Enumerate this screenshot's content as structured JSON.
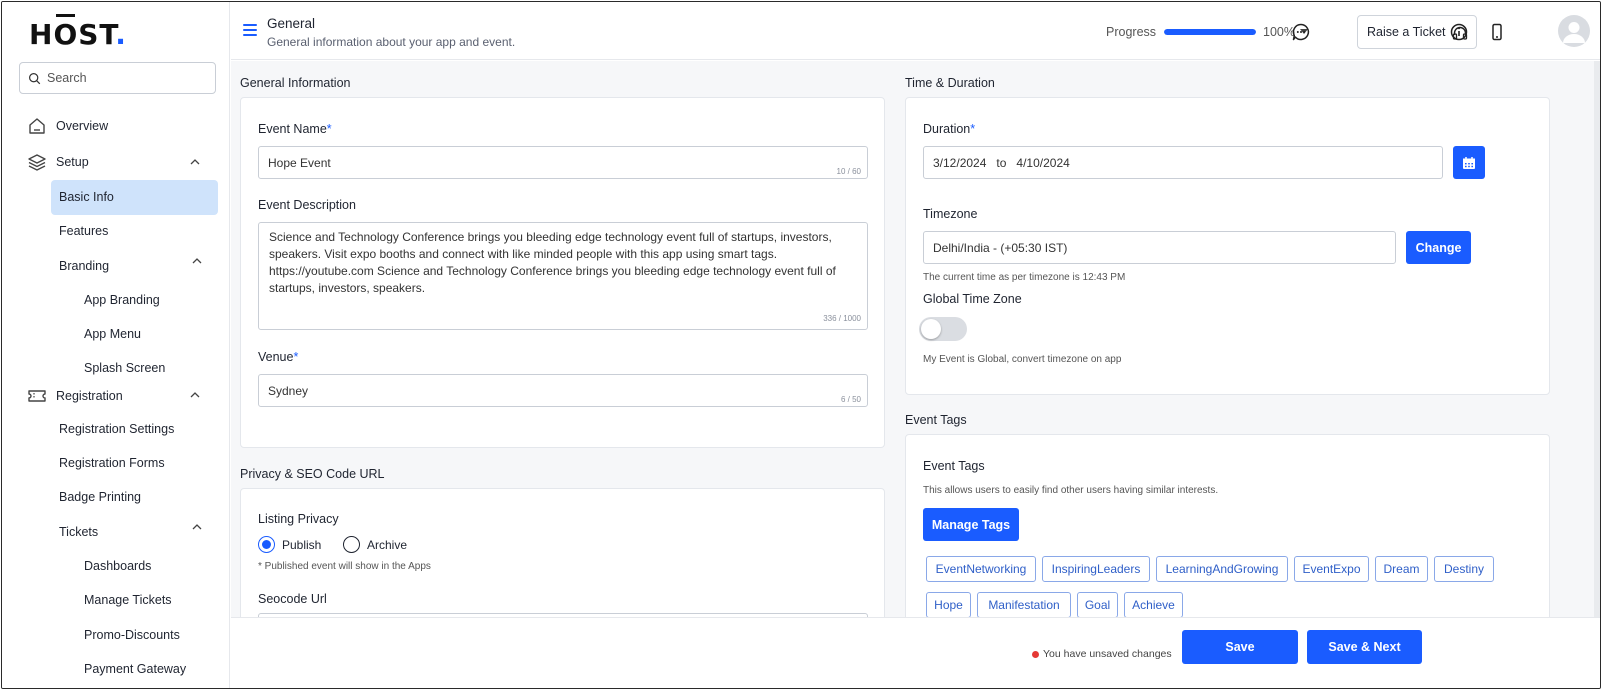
{
  "brand": {
    "logo_text_a": "H",
    "logo_text_o": "O",
    "logo_text_b": "ST",
    "logo_dot": ".",
    "accent": "#1a5cff"
  },
  "search": {
    "placeholder": "Search"
  },
  "sidebar": {
    "overview": "Overview",
    "setup": "Setup",
    "basic_info": "Basic Info",
    "features": "Features",
    "branding": "Branding",
    "app_branding": "App Branding",
    "app_menu": "App Menu",
    "splash_screen": "Splash Screen",
    "registration": "Registration",
    "registration_settings": "Registration Settings",
    "registration_forms": "Registration Forms",
    "badge_printing": "Badge Printing",
    "tickets": "Tickets",
    "dashboards": "Dashboards",
    "manage_tickets": "Manage Tickets",
    "promo_discounts": "Promo-Discounts",
    "payment_gateway": "Payment Gateway"
  },
  "header": {
    "title": "General",
    "subtitle": "General information about your app and event.",
    "progress_label": "Progress",
    "progress_value": "100%",
    "progress_fraction": 1.0,
    "raise_ticket": "Raise a Ticket"
  },
  "general_info": {
    "section_title": "General Information",
    "event_name_label": "Event Name",
    "event_name_value": "Hope Event",
    "event_name_counter": "10 / 60",
    "event_desc_label": "Event Description",
    "event_desc_value": "Science and Technology Conference brings you bleeding edge technology event full of startups, investors, speakers. Visit expo booths and connect with like minded people with this app using smart tags. https://youtube.com Science and Technology Conference brings you bleeding edge technology event full of startups, investors, speakers.",
    "event_desc_counter": "336 / 1000",
    "venue_label": "Venue",
    "venue_value": "Sydney",
    "venue_counter": "6 / 50",
    "required_mark": "*"
  },
  "privacy": {
    "section_title": "Privacy & SEO Code URL",
    "listing_privacy_label": "Listing Privacy",
    "publish": "Publish",
    "archive": "Archive",
    "note": "* Published event will show in the Apps",
    "seocode_label": "Seocode Url"
  },
  "time": {
    "section_title": "Time & Duration",
    "duration_label": "Duration",
    "start_date": "3/12/2024",
    "to": "to",
    "end_date": "4/10/2024",
    "timezone_label": "Timezone",
    "timezone_value": "Delhi/India - (+05:30 IST)",
    "change_button": "Change",
    "timezone_note": "The current time as per timezone is 12:43 PM",
    "global_tz_label": "Global Time Zone",
    "global_tz_note": "My Event is Global, convert timezone on app"
  },
  "tags": {
    "section_title": "Event Tags",
    "card_title": "Event Tags",
    "desc": "This allows users to easily find other users having similar interests.",
    "manage_button": "Manage Tags",
    "items": [
      "EventNetworking",
      "InspiringLeaders",
      "LearningAndGrowing",
      "EventExpo",
      "Dream",
      "Destiny",
      "Hope",
      "Manifestation",
      "Goal",
      "Achieve"
    ]
  },
  "footer": {
    "unsaved": "You have unsaved changes",
    "save": "Save",
    "save_next": "Save & Next"
  }
}
